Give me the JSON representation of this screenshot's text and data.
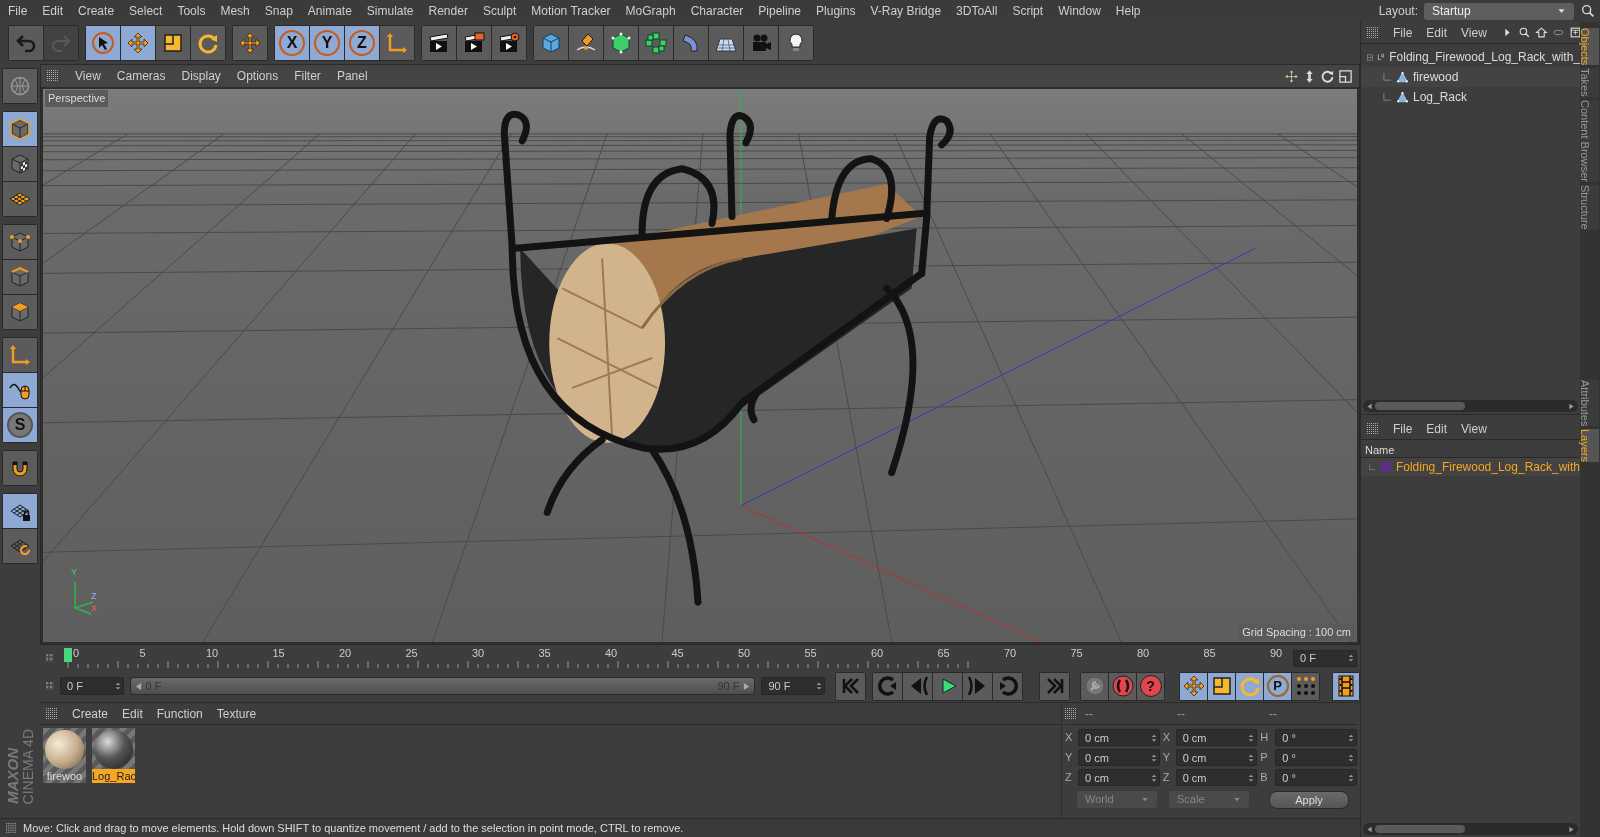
{
  "menu_bar": [
    "File",
    "Edit",
    "Create",
    "Select",
    "Tools",
    "Mesh",
    "Snap",
    "Animate",
    "Simulate",
    "Render",
    "Sculpt",
    "Motion Tracker",
    "MoGraph",
    "Character",
    "Pipeline",
    "Plugins",
    "V-Ray Bridge",
    "3DToAll",
    "Script",
    "Window",
    "Help"
  ],
  "layout": {
    "label": "Layout:",
    "value": "Startup"
  },
  "toolbar": [
    [
      {
        "kind": "undo",
        "selected": false,
        "disabled": false
      },
      {
        "kind": "redo",
        "selected": false,
        "disabled": true
      }
    ],
    [
      {
        "kind": "cursor",
        "selected": true,
        "disabled": false
      },
      {
        "kind": "move",
        "selected": true,
        "disabled": false
      },
      {
        "kind": "scale",
        "selected": false,
        "disabled": false
      },
      {
        "kind": "rotate",
        "selected": false,
        "disabled": false
      }
    ],
    [
      {
        "kind": "move",
        "selected": false,
        "disabled": false
      }
    ],
    [
      {
        "kind": "axis",
        "label": "X",
        "selected": true,
        "disabled": false
      },
      {
        "kind": "axis",
        "label": "Y",
        "selected": true,
        "disabled": false
      },
      {
        "kind": "axis",
        "label": "Z",
        "selected": true,
        "disabled": false
      },
      {
        "kind": "axes",
        "selected": false,
        "disabled": false
      }
    ],
    [
      {
        "kind": "clapboard",
        "selected": false,
        "disabled": false
      },
      {
        "kind": "clapboard-window",
        "selected": false,
        "disabled": false
      },
      {
        "kind": "clapboard-gear",
        "selected": false,
        "disabled": false
      }
    ],
    [
      {
        "kind": "cube",
        "selected": false,
        "disabled": false
      },
      {
        "kind": "pen",
        "selected": false,
        "disabled": false
      },
      {
        "kind": "subdivision-cube",
        "selected": false,
        "disabled": false
      },
      {
        "kind": "cubes-ring",
        "selected": false,
        "disabled": false
      },
      {
        "kind": "bend",
        "selected": false,
        "disabled": false
      },
      {
        "kind": "floor-grid",
        "selected": false,
        "disabled": false
      },
      {
        "kind": "camera",
        "selected": false,
        "disabled": false
      },
      {
        "kind": "light-bulb",
        "selected": false,
        "disabled": false
      }
    ]
  ],
  "left_tools": [
    [
      {
        "kind": "globe",
        "selected": false
      }
    ],
    [
      {
        "kind": "model-cube",
        "selected": true
      },
      {
        "kind": "checker-cube",
        "selected": false
      },
      {
        "kind": "workplane",
        "selected": false
      }
    ],
    [
      {
        "kind": "points-cube",
        "selected": false
      },
      {
        "kind": "edges-cube",
        "selected": false
      },
      {
        "kind": "polygons-cube",
        "selected": false
      }
    ],
    [
      {
        "kind": "axes",
        "selected": false
      },
      {
        "kind": "mouse",
        "selected": true
      },
      {
        "kind": "snap",
        "label": "S",
        "selected": true
      }
    ],
    [
      {
        "kind": "magnet",
        "selected": false
      }
    ],
    [
      {
        "kind": "grid-lock",
        "selected": true
      },
      {
        "kind": "grid-rotate",
        "selected": false
      }
    ]
  ],
  "logo_text": [
    "MAXON",
    "CINEMA 4D"
  ],
  "viewport": {
    "menus": [
      "View",
      "Cameras",
      "Display",
      "Options",
      "Filter",
      "Panel"
    ],
    "camera": "Perspective",
    "grid_spacing": "Grid Spacing : 100 cm",
    "axis_labels": [
      "Y",
      "Z",
      "X"
    ]
  },
  "timeline": {
    "ticks": [
      "0",
      "5",
      "10",
      "15",
      "20",
      "25",
      "30",
      "35",
      "40",
      "45",
      "50",
      "55",
      "60",
      "65",
      "70",
      "75",
      "80",
      "85",
      "90"
    ],
    "level": 0,
    "current_frame": "0 F",
    "start_field": "0 F",
    "range": {
      "start": "0 F",
      "end": "90 F",
      "level": 1
    },
    "end_field": "90 F",
    "playback": [
      [
        {
          "kind": "skip-start"
        }
      ],
      [
        {
          "kind": "loop-left"
        },
        {
          "kind": "step-back"
        },
        {
          "kind": "play"
        },
        {
          "kind": "step-forward"
        },
        {
          "kind": "loop-right"
        }
      ],
      [
        {
          "kind": "skip-end"
        }
      ]
    ],
    "keys": [
      {
        "kind": "key",
        "selected": false
      },
      {
        "kind": "record",
        "selected": false
      },
      {
        "kind": "help",
        "label": "?",
        "selected": false
      }
    ],
    "key_tools": [
      {
        "kind": "move",
        "selected": true
      },
      {
        "kind": "scale",
        "selected": true
      },
      {
        "kind": "rotate",
        "selected": true
      },
      {
        "kind": "param",
        "label": "P",
        "selected": true
      },
      {
        "kind": "dots",
        "selected": false
      }
    ],
    "film": {
      "selected": true
    }
  },
  "materials": {
    "menus": [
      "Create",
      "Edit",
      "Function",
      "Texture"
    ],
    "items": [
      {
        "name": "firewoo",
        "kind": "wood",
        "selected": false
      },
      {
        "name": "Log_Rac",
        "kind": "metal",
        "selected": true
      }
    ]
  },
  "coordinates": {
    "headers": [
      "--",
      "--",
      "--"
    ],
    "rows": [
      {
        "axis": "X",
        "position": "0 cm",
        "size_axis": "X",
        "size": "0 cm",
        "rot_axis": "H",
        "rotation": "0 °"
      },
      {
        "axis": "Y",
        "position": "0 cm",
        "size_axis": "Y",
        "size": "0 cm",
        "rot_axis": "P",
        "rotation": "0 °"
      },
      {
        "axis": "Z",
        "position": "0 cm",
        "size_axis": "Z",
        "size": "0 cm",
        "rot_axis": "B",
        "rotation": "0 °"
      }
    ],
    "dropdowns": [
      "World",
      "Scale"
    ],
    "apply": "Apply"
  },
  "status_bar": "Move: Click and drag to move elements. Hold down SHIFT to quantize movement / add to the selection in point mode, CTRL to remove.",
  "objects_panel": {
    "menus": [
      "File",
      "Edit",
      "View"
    ],
    "tree": [
      {
        "name": "Folding_Firewood_Log_Rack_with_",
        "kind": "null",
        "expanded": true,
        "children": [
          {
            "name": "firewood",
            "kind": "polygon"
          },
          {
            "name": "Log_Rack",
            "kind": "polygon"
          }
        ]
      }
    ]
  },
  "layers_panel": {
    "menus": [
      "File",
      "Edit",
      "View"
    ],
    "column": "Name",
    "layers": [
      {
        "name": "Folding_Firewood_Log_Rack_with",
        "color": "#5c2f86"
      }
    ]
  },
  "side_tabs_top": [
    {
      "label": "Objects",
      "selected": true
    },
    {
      "label": "Takes",
      "selected": false
    },
    {
      "label": "Content Browser",
      "selected": false
    },
    {
      "label": "Structure",
      "selected": false
    }
  ],
  "side_tabs_bottom": [
    {
      "label": "Attributes",
      "selected": false
    },
    {
      "label": "Layers",
      "selected": true
    }
  ]
}
